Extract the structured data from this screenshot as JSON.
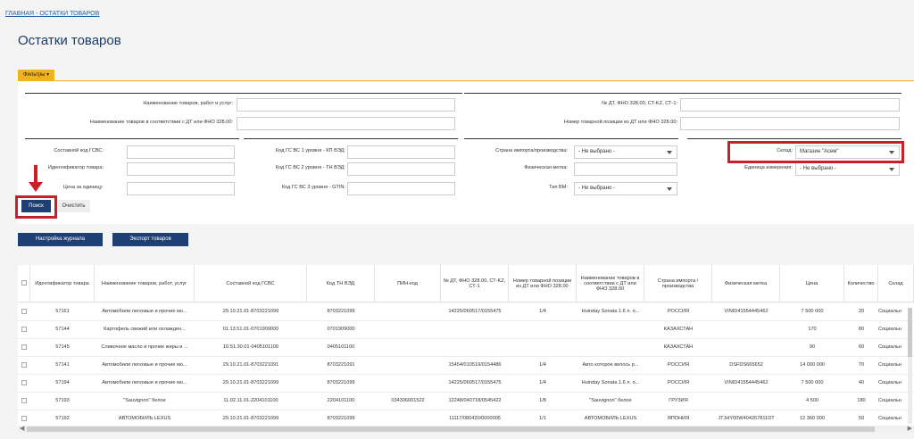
{
  "breadcrumb": {
    "home": "ГЛАВНАЯ",
    "sep": "-",
    "current": "ОСТАТКИ ТОВАРОВ"
  },
  "page_title": "Остатки товаров",
  "filters_tab": "Фильтры",
  "filters": {
    "name_label": "Наименование товаров, работ и услуг:",
    "name_dt_label": "Наименование товаров в соответствии с ДТ или ФНО 328.00:",
    "dt_num_label": "№ ДТ, ФНО 328.00, СТ-KZ, СТ-1:",
    "dt_pos_label": "Номер товарной позиции из ДТ или ФНО 328.00:",
    "gsvs_label": "Составной код ГСВС:",
    "item_id_label": "Идентификатор товара:",
    "unit_price_label": "Цена за единицу:",
    "gs1_label": "Код ГС ВС 1 уровня - КП ВЭД:",
    "gs2_label": "Код ГС ВС 2 уровня - ТН ВЭД:",
    "gs3_label": "Код ГС ВС 3 уровня - GTIN:",
    "country_label": "Страна импорта/производства:",
    "country_value": "- Не выбрано -",
    "phys_label": "Физическая метка:",
    "vm_label": "Тип ВМ:",
    "vm_value": "- Не выбрано -",
    "warehouse_label": "Склад:",
    "warehouse_value": "Магазин \"Асем\"",
    "unit_label": "Единица измерения:",
    "unit_value": "- Не выбрано -"
  },
  "buttons": {
    "search": "Поиск",
    "clear": "Очистить",
    "journal": "Настройка журнала",
    "export": "Экспорт товаров"
  },
  "colors": {
    "primary": "#1e3f73",
    "accent": "#f0b31f",
    "highlight": "#c8202b"
  },
  "table": {
    "headers": [
      "Идентификатор товара",
      "Наименование товаров, работ, услуг",
      "Составной код ГСВС",
      "Код ТН ВЭД",
      "ПИН-код",
      "№ ДТ, ФНО 328.00, СТ-KZ, СТ-1",
      "Номер товарной позиции из ДТ или ФНО 328.00",
      "Наименование товаров в соответствии с ДТ или ФНО 328.00",
      "Страна импорта / производства",
      "Физическая метка",
      "Цена",
      "Количество",
      "Склад"
    ],
    "rows": [
      [
        "57161",
        "Автомобили легковые и прочие мо...",
        "29.10.21.01-8703221099",
        "8703221099",
        "",
        "14225/060517/0155475",
        "1/4",
        "Huinday Sonata 1.6 л. о...",
        "РОССИЯ",
        "VINID41554445462",
        "7 500 000",
        "20",
        "Социальн"
      ],
      [
        "57144",
        "Картофель свежий или охлажден...",
        "01.13.51.01-0701909000",
        "0701909000",
        "",
        "",
        "",
        "",
        "КАЗАХСТАН",
        "",
        "170",
        "80",
        "Социальн"
      ],
      [
        "57145",
        "Сливочное масло и прочие жиры и ...",
        "10.51.30.01-0405101100",
        "0405101100",
        "",
        "",
        "",
        "",
        "КАЗАХСТАН",
        "",
        "90",
        "60",
        "Социальн"
      ],
      [
        "57141",
        "Автомобили легковые и прочие мо...",
        "29.10.21.01-8703221091",
        "8703221091",
        "",
        "15454/010519/0154486",
        "1/4",
        "Авто которое велось р...",
        "РОССИЯ",
        "DSFDS665652",
        "14 000 000",
        "70",
        "Социальн"
      ],
      [
        "57194",
        "Автомобили легковые и прочие мо...",
        "29.10.21.01-8703221099",
        "8703221099",
        "",
        "14225/060517/0155475",
        "1/4",
        "Huinday Sonata 1.6 л. о...",
        "РОССИЯ",
        "VINID41554445462",
        "7 500 000",
        "40",
        "Социальн"
      ],
      [
        "57193",
        "\"Sauvignon\" белое",
        "11.02.11.01-2204101100",
        "2204101100",
        "034306001522",
        "12248/040718/0545422",
        "1/8",
        "\"Sauvignon\" белое",
        "ГРУЗИЯ",
        "",
        "4 500",
        "180",
        "Социальн"
      ],
      [
        "57192",
        "АВТОМОБИЛЬ LEXUS",
        "29.10.21.01-8703221099",
        "8703221099",
        "",
        "11117/080420/0000005",
        "1/1",
        "АВТОМОБИЛЬ LEXUS",
        "ЯПОНИЯ",
        "JTJHY00W404267811DT",
        "12 360 000",
        "50",
        "Социальн"
      ]
    ]
  }
}
